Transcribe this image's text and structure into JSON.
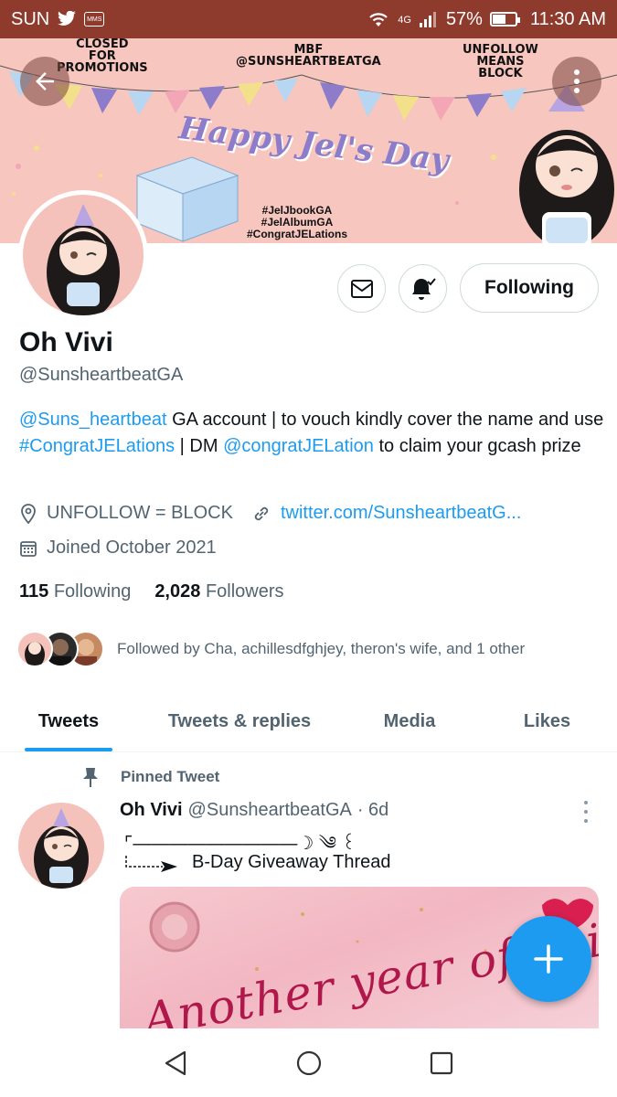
{
  "status_bar": {
    "carrier": "SUN",
    "mms_label": "MMS",
    "network": "4G",
    "battery": "57%",
    "battery_level": 0.57,
    "time": "11:30 AM"
  },
  "banner": {
    "closed": "CLOSED\nFOR\nPROMOTIONS",
    "mbf": "MBF\n@SUNSHEARTBEATGA",
    "unfollow": "UNFOLLOW\nMEANS\nBLOCK",
    "happy": "Happy Jel's Day",
    "hashtags": "#JelJbookGA\n#JelAlbumGA\n#CongratJELations"
  },
  "profile": {
    "name": "Oh Vivi",
    "handle": "@SunsheartbeatGA",
    "follow_state": "Following",
    "bio_mention1": "@Suns_heartbeat",
    "bio_text1": " GA account | to vouch kindly cover the name and use ",
    "bio_hashtag": "#CongratJELations",
    "bio_text2": " | DM ",
    "bio_mention2": "@congratJELation",
    "bio_text3": " to claim your gcash prize",
    "location": "UNFOLLOW = BLOCK",
    "website": "twitter.com/SunsheartbeatG...",
    "joined": "Joined October 2021",
    "following_count": "115",
    "following_label": "Following",
    "followers_count": "2,028",
    "followers_label": "Followers",
    "followed_by": "Followed by Cha, achillesdfghjey, theron's wife, and 1 other"
  },
  "tabs": [
    "Tweets",
    "Tweets & replies",
    "Media",
    "Likes"
  ],
  "pinned_tweet": {
    "pinned_label": "Pinned Tweet",
    "author": "Oh Vivi",
    "handle": "@SunsheartbeatGA",
    "time": "· 6d",
    "line1": "⌜―――――――――☽ ༄ ꒰",
    "line2": "B-Day Giveaway Thread",
    "media_text": "Another year of being maganda ^"
  },
  "colors": {
    "accent": "#1d9bf0",
    "status_bar": "#8e3a2c",
    "banner_bg": "#f6c6bf"
  },
  "icons": {
    "back": "arrow-left-icon",
    "more": "more-vertical-icon",
    "message": "envelope-icon",
    "notify": "bell-check-icon",
    "location": "location-pin-icon",
    "link": "link-icon",
    "calendar": "calendar-icon",
    "pin": "pin-icon",
    "compose": "plus-icon"
  }
}
